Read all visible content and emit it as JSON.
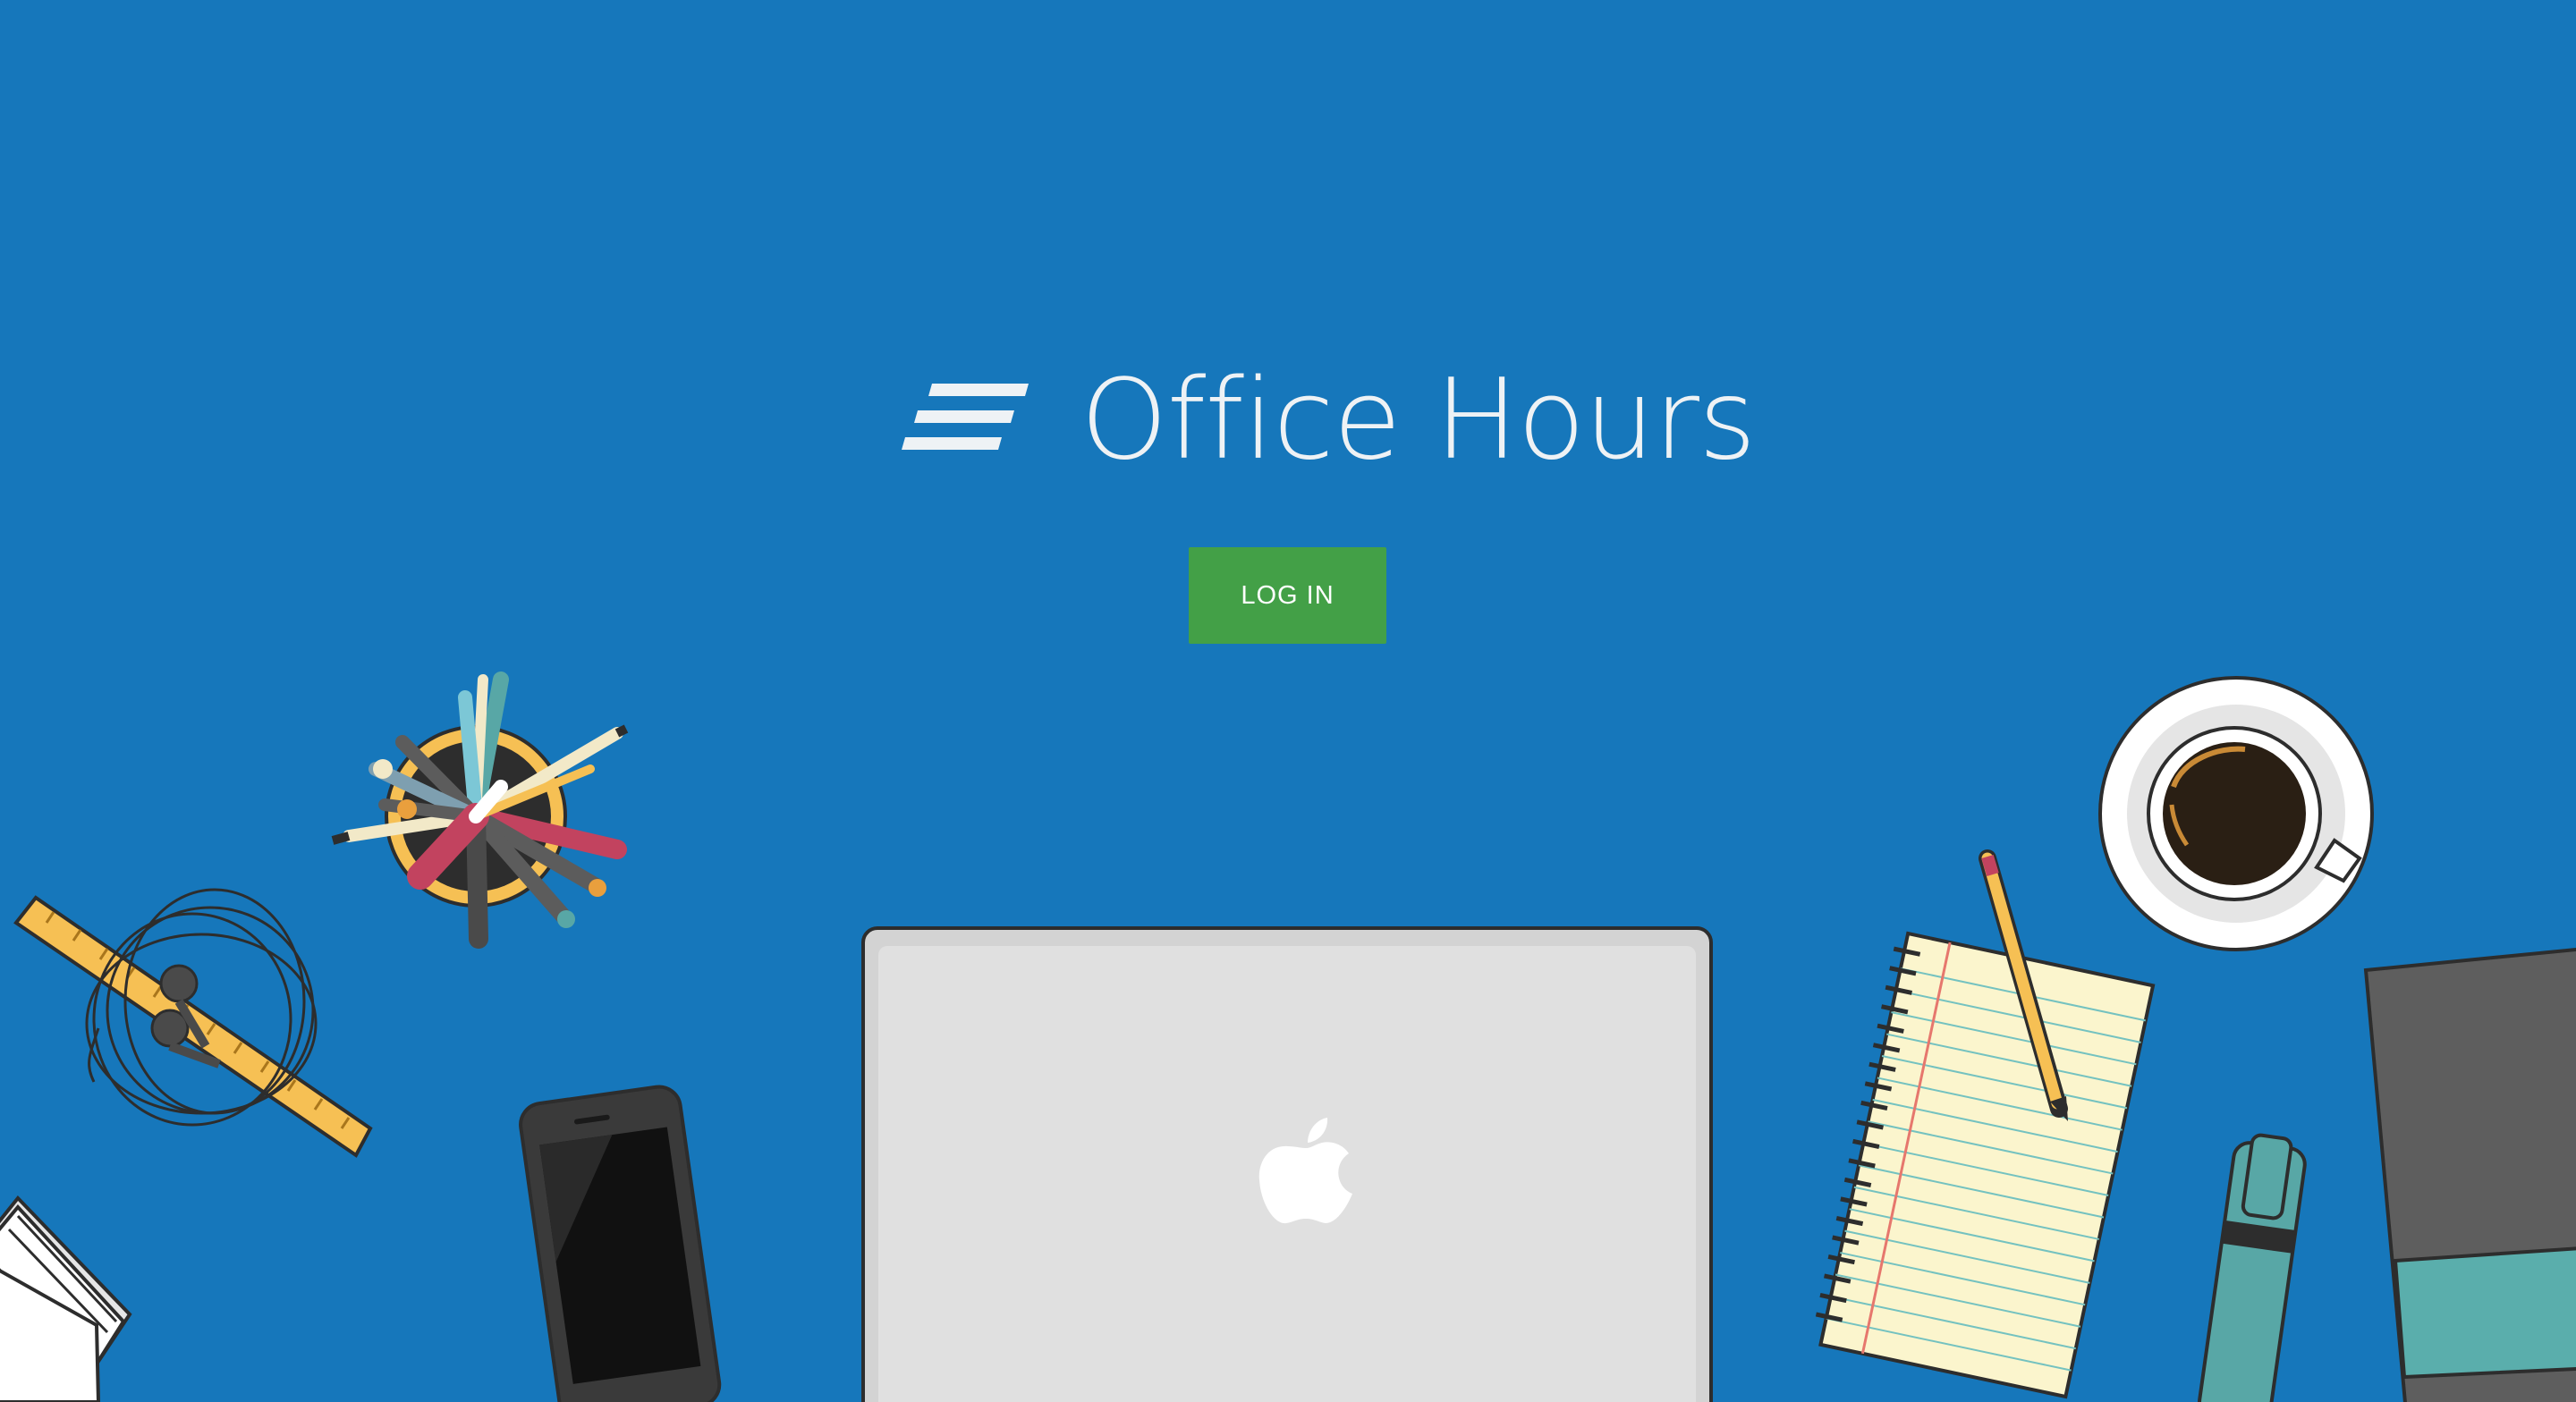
{
  "app": {
    "title": "Office Hours",
    "logo_icon": "stacked-lines-logo-icon"
  },
  "login": {
    "label": "LOG IN"
  },
  "theme": {
    "background": "#1677bb",
    "button": "#43a047",
    "title_color": "#eef2f5"
  },
  "illustration": {
    "items": [
      "pencil-cup",
      "ruler",
      "earphones",
      "smartphone",
      "laptop",
      "apple-logo",
      "notepad",
      "pencil",
      "coffee-cup",
      "highlighter",
      "notebook",
      "paper-stack"
    ]
  }
}
